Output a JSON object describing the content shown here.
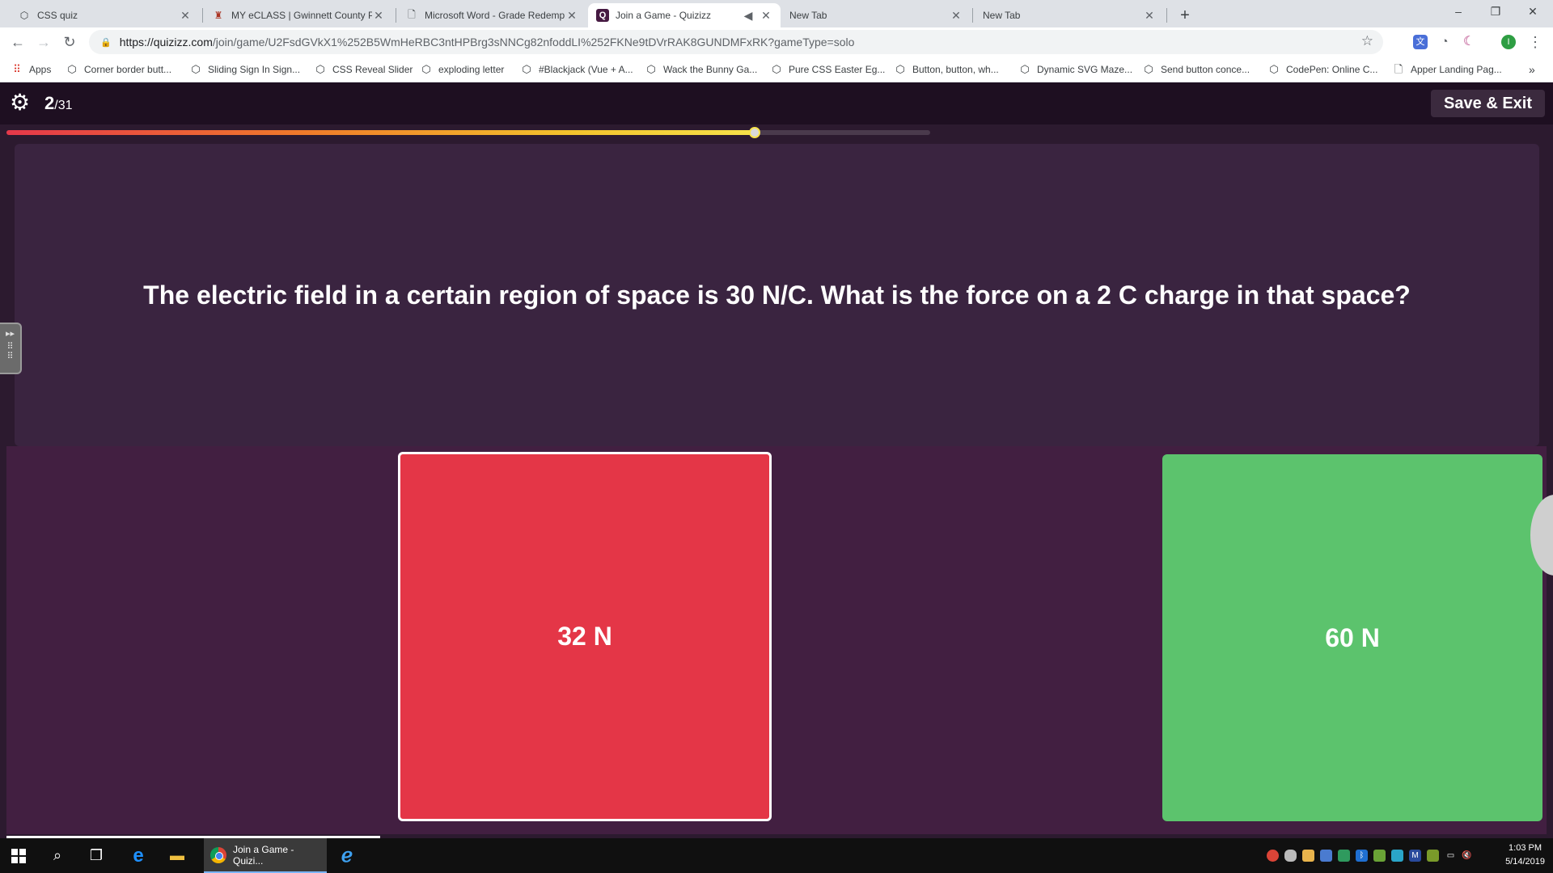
{
  "browser": {
    "tabs": [
      {
        "title": "CSS quiz",
        "icon": "codepen-icon",
        "active": false
      },
      {
        "title": "MY eCLASS | Gwinnett County Pu",
        "icon": "eclass-icon",
        "active": false
      },
      {
        "title": "Microsoft Word - Grade Redemp",
        "icon": "document-icon",
        "active": false
      },
      {
        "title": "Join a Game - Quizizz",
        "icon": "quizizz-icon",
        "active": true
      },
      {
        "title": "New Tab",
        "icon": "",
        "active": false
      },
      {
        "title": "New Tab",
        "icon": "",
        "active": false
      }
    ],
    "new_tab_label": "+",
    "window_controls": {
      "minimize": "–",
      "restore": "❐",
      "close": "✕"
    },
    "url": {
      "host": "https://quizizz.com",
      "path": "/join/game/U2FsdGVkX1%252B5WmHeRBC3ntHPBrg3sNNCg82nfoddLI%252FKNe9tDVrRAK8GUNDMFxRK?gameType=solo"
    },
    "bookmarks": [
      {
        "label": "Apps",
        "icon": "apps-grid-icon"
      },
      {
        "label": "Corner border butt...",
        "icon": "codepen-icon"
      },
      {
        "label": "Sliding Sign In Sign...",
        "icon": "codepen-icon"
      },
      {
        "label": "CSS Reveal Slider",
        "icon": "codepen-icon"
      },
      {
        "label": "exploding letter",
        "icon": "codepen-icon"
      },
      {
        "label": "#Blackjack (Vue + A...",
        "icon": "codepen-icon"
      },
      {
        "label": "Wack the Bunny Ga...",
        "icon": "codepen-icon"
      },
      {
        "label": "Pure CSS Easter Eg...",
        "icon": "codepen-icon"
      },
      {
        "label": "Button, button, wh...",
        "icon": "codepen-icon"
      },
      {
        "label": "Dynamic SVG Maze...",
        "icon": "codepen-icon"
      },
      {
        "label": "Send button conce...",
        "icon": "codepen-icon"
      },
      {
        "label": "CodePen: Online C...",
        "icon": "codepen-icon"
      },
      {
        "label": "Apper Landing Pag...",
        "icon": "document-icon"
      }
    ],
    "bookmarks_overflow": "»",
    "profile_initial": "I"
  },
  "quiz": {
    "current_question": "2",
    "separator": "/",
    "total_questions": "31",
    "save_exit_label": "Save & Exit",
    "timer_progress": 0.81,
    "question": "The electric field in a certain region of space is 30 N/C. What is the force on a 2 C charge in that space?",
    "options": [
      {
        "label": "32 N",
        "color": "#e43647"
      },
      {
        "label": "60 N",
        "color": "#5cc36d"
      }
    ]
  },
  "colors": {
    "page_bg": "#2c1a2f",
    "topbar_bg": "#1e0f21",
    "question_bg": "#3a2440",
    "options_bg": "#421f41"
  },
  "taskbar": {
    "app_label": "Join a Game - Quizi...",
    "time": "1:03 PM",
    "date": "5/14/2019"
  }
}
